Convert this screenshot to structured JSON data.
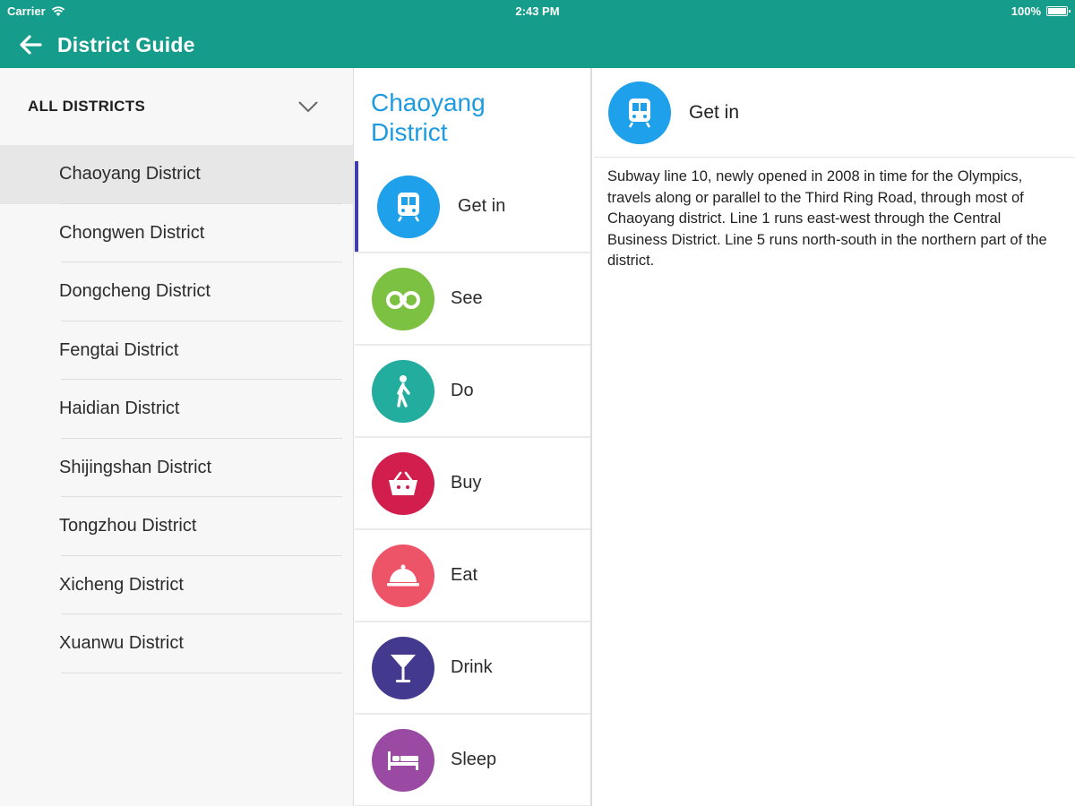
{
  "status_bar": {
    "carrier": "Carrier",
    "time": "2:43 PM",
    "battery": "100%"
  },
  "nav": {
    "title": "District Guide",
    "back_icon": "arrow-left-icon"
  },
  "colors": {
    "header_bg": "#169c8a",
    "accent_blue": "#1e9be0",
    "selection_bar": "#3f3db0"
  },
  "sidebar": {
    "filter_label": "ALL DISTRICTS",
    "filter_icon": "chevron-down-icon",
    "items": [
      {
        "label": "Chaoyang District",
        "selected": true
      },
      {
        "label": "Chongwen District"
      },
      {
        "label": "Dongcheng District"
      },
      {
        "label": "Fengtai District"
      },
      {
        "label": "Haidian District"
      },
      {
        "label": "Shijingshan District"
      },
      {
        "label": "Tongzhou District"
      },
      {
        "label": "Xicheng District"
      },
      {
        "label": "Xuanwu District"
      }
    ]
  },
  "district": {
    "title_line1": "Chaoyang",
    "title_line2": "District"
  },
  "categories": [
    {
      "label": "Get in",
      "icon": "train-icon",
      "color": "#1ea0ea",
      "selected": true
    },
    {
      "label": "See",
      "icon": "binoculars-icon",
      "color": "#7cc142"
    },
    {
      "label": "Do",
      "icon": "person-walking-icon",
      "color": "#22ad9f"
    },
    {
      "label": "Buy",
      "icon": "shopping-basket-icon",
      "color": "#d11e4c"
    },
    {
      "label": "Eat",
      "icon": "food-cloche-icon",
      "color": "#ee5468"
    },
    {
      "label": "Drink",
      "icon": "cocktail-glass-icon",
      "color": "#43398f"
    },
    {
      "label": "Sleep",
      "icon": "bed-icon",
      "color": "#9a4aa2"
    }
  ],
  "detail": {
    "title": "Get in",
    "icon": "train-icon",
    "body": "Subway line 10, newly opened in 2008 in time for the Olympics, travels along or parallel to the Third Ring Road, through most of Chaoyang district. Line 1 runs east-west through the Central Business District. Line 5 runs north-south in the northern part of the district."
  }
}
